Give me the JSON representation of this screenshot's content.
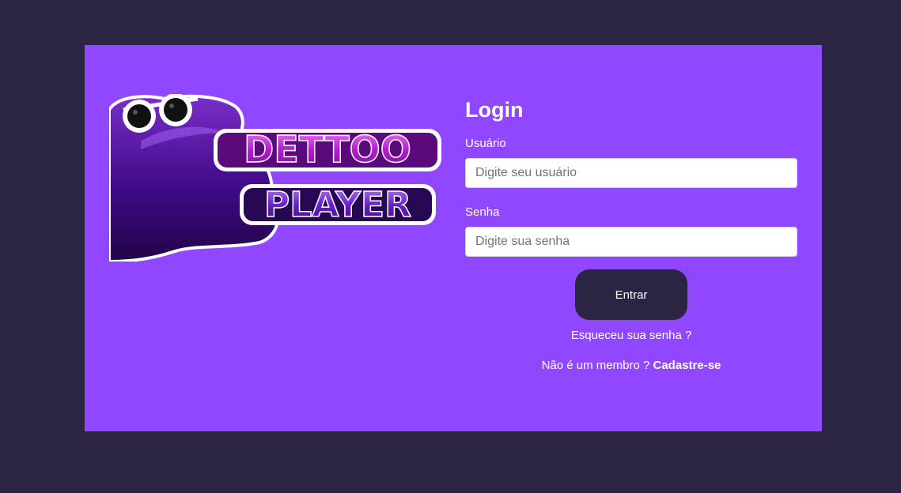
{
  "colors": {
    "background": "#2b2543",
    "card": "#9147ff",
    "button": "#2b2543",
    "text": "#ffffff"
  },
  "logo": {
    "line1": "DETTOO",
    "line2": "PLAYER"
  },
  "login": {
    "title": "Login",
    "username_label": "Usuário",
    "username_placeholder": "Digite seu usuário",
    "username_value": "",
    "password_label": "Senha",
    "password_placeholder": "Digite sua senha",
    "password_value": "",
    "submit_label": "Entrar",
    "forgot_link": "Esqueceu sua senha ?",
    "member_prompt": "Não é um membro ?",
    "signup_link": "Cadastre-se"
  }
}
